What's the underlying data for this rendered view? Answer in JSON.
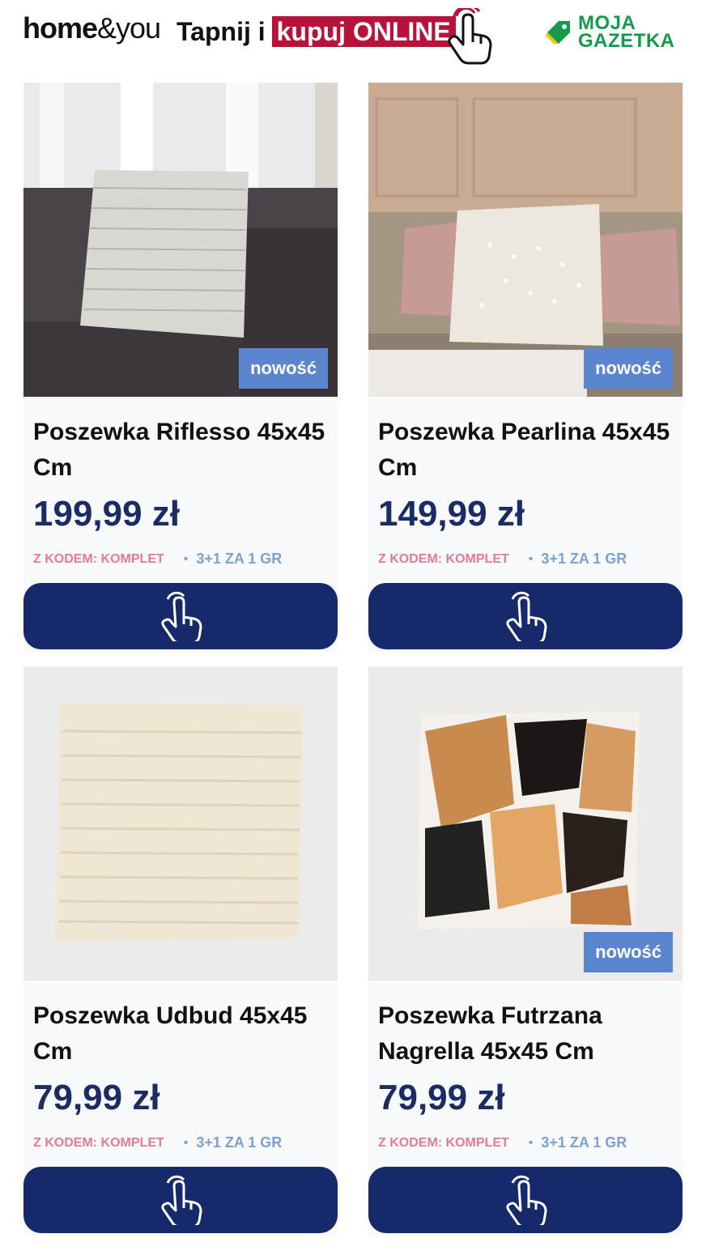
{
  "header": {
    "brand_bold": "home",
    "brand_light": "&you",
    "tagline_prefix": "Tapnij i",
    "tagline_highlight": "kupuj ONLINE",
    "gazetka_line1": "MOJA",
    "gazetka_line2": "GAZETKA"
  },
  "colors": {
    "navy": "#15296b",
    "badge": "#5b86cf",
    "accent_red": "#b8123a",
    "green": "#139a4a"
  },
  "products": [
    {
      "title": "Poszewka Riflesso 45x45 Cm",
      "price": "199,99 zł",
      "badge": "nowość",
      "promo_code": "Z KODEM: KOMPLET",
      "promo_deal": "3+1 ZA 1 GR",
      "icon": "tap-hand-icon"
    },
    {
      "title": "Poszewka Pearlina 45x45 Cm",
      "price": "149,99 zł",
      "badge": "nowość",
      "promo_code": "Z KODEM: KOMPLET",
      "promo_deal": "3+1 ZA 1 GR",
      "icon": "tap-hand-icon"
    },
    {
      "title": "Poszewka Udbud 45x45 Cm",
      "price": "79,99 zł",
      "badge": "",
      "promo_code": "Z KODEM: KOMPLET",
      "promo_deal": "3+1 ZA 1 GR",
      "icon": "tap-hand-icon"
    },
    {
      "title": "Poszewka Futrzana Nagrella 45x45 Cm",
      "price": "79,99 zł",
      "badge": "nowość",
      "promo_code": "Z KODEM: KOMPLET",
      "promo_deal": "3+1 ZA 1 GR",
      "icon": "tap-hand-icon"
    }
  ]
}
